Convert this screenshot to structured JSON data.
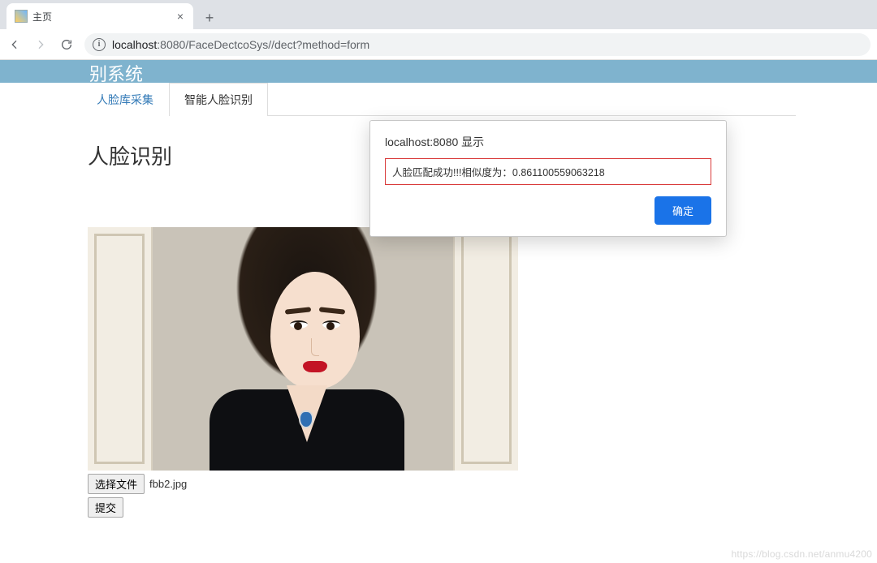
{
  "browser": {
    "tab_title": "主页",
    "new_tab_label": "+",
    "url_host": "localhost",
    "url_port": ":8080",
    "url_path": "/FaceDectcoSys//dect?method=form"
  },
  "banner": {
    "title_fragment": "别系统"
  },
  "tabs": {
    "items": [
      {
        "label": "人脸库采集",
        "active": false
      },
      {
        "label": "智能人脸识别",
        "active": true
      }
    ]
  },
  "page": {
    "heading": "人脸识别",
    "file_button": "选择文件",
    "filename": "fbb2.jpg",
    "submit": "提交"
  },
  "dialog": {
    "title": "localhost:8080 显示",
    "message": "人脸匹配成功!!!相似度为：0.861100559063218",
    "confirm": "确定"
  },
  "watermark": "https://blog.csdn.net/anmu4200"
}
